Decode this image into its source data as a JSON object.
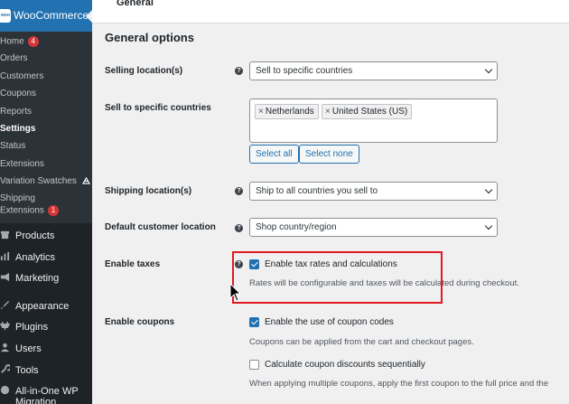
{
  "sidebar": {
    "woocommerce_label": "WooCommerce",
    "woo_logo": "woo",
    "submenu": [
      {
        "label": "Home",
        "badge": "4"
      },
      {
        "label": "Orders"
      },
      {
        "label": "Customers"
      },
      {
        "label": "Coupons"
      },
      {
        "label": "Reports"
      },
      {
        "label": "Settings",
        "active": true
      },
      {
        "label": "Status"
      },
      {
        "label": "Extensions"
      },
      {
        "label": "Variation Swatches"
      },
      {
        "label": "Shipping"
      },
      {
        "label": "Extensions",
        "badge": "1"
      }
    ],
    "menu": [
      {
        "label": "Products",
        "icon": "archive-icon"
      },
      {
        "label": "Analytics",
        "icon": "bar-chart-icon"
      },
      {
        "label": "Marketing",
        "icon": "megaphone-icon"
      },
      {
        "label": "Appearance",
        "icon": "paintbrush-icon"
      },
      {
        "label": "Plugins",
        "icon": "plug-icon"
      },
      {
        "label": "Users",
        "icon": "user-icon"
      },
      {
        "label": "Tools",
        "icon": "wrench-icon"
      },
      {
        "label": "All-in-One WP",
        "icon": "migration-icon"
      },
      {
        "label": "Migration"
      }
    ]
  },
  "tabs": {
    "general": "General"
  },
  "section_title": "General options",
  "fields": {
    "selling_location": {
      "label": "Selling location(s)",
      "value": "Sell to specific countries"
    },
    "sell_to_specific": {
      "label": "Sell to specific countries",
      "chips": [
        "Netherlands",
        "United States (US)"
      ],
      "chip_remove": "×",
      "select_all": "Select all",
      "select_none": "Select none"
    },
    "shipping_location": {
      "label": "Shipping location(s)",
      "value": "Ship to all countries you sell to"
    },
    "default_customer_location": {
      "label": "Default customer location",
      "value": "Shop country/region"
    },
    "enable_taxes": {
      "label": "Enable taxes",
      "checkbox_label": "Enable tax rates and calculations",
      "checked": true,
      "description": "Rates will be configurable and taxes will be calculated during checkout."
    },
    "enable_coupons": {
      "label": "Enable coupons",
      "checkbox_label": "Enable the use of coupon codes",
      "checked": true,
      "description": "Coupons can be applied from the cart and checkout pages.",
      "sequential_label": "Calculate coupon discounts sequentially",
      "sequential_checked": false,
      "sequential_description": "When applying multiple coupons, apply the first coupon to the full price and the"
    }
  },
  "help_glyph": "?",
  "colors": {
    "highlight": "#e01b24",
    "accent": "#2271b1",
    "badge": "#d63638"
  }
}
